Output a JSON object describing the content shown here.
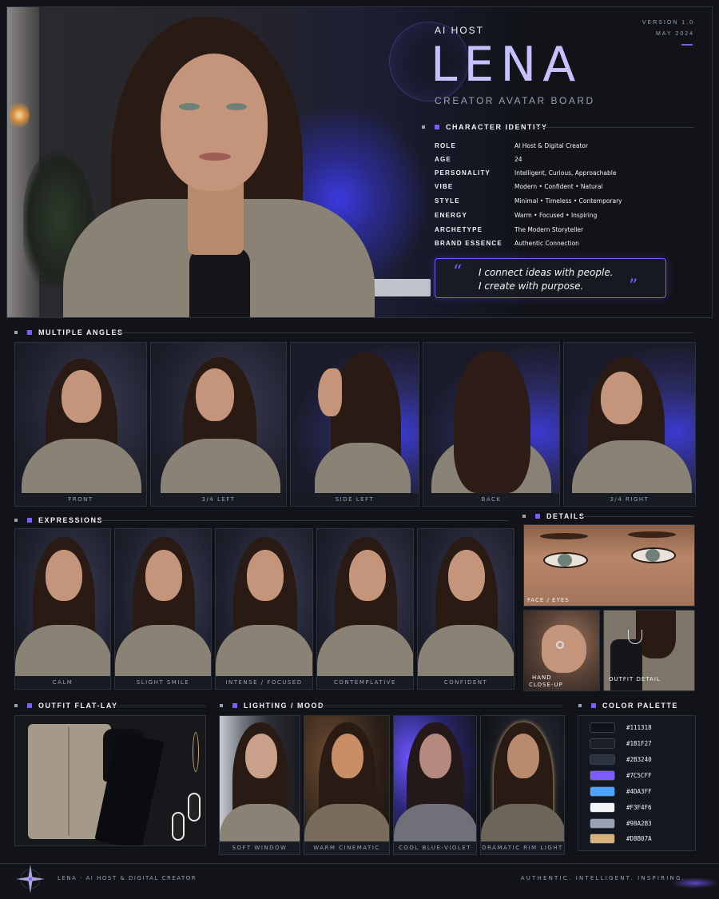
{
  "header": {
    "version": "VERSION 1.0",
    "date": "MAY 2024",
    "eyebrow": "AI HOST",
    "name": "LENA",
    "subtitle": "CREATOR AVATAR BOARD"
  },
  "identity": {
    "title": "CHARACTER IDENTITY",
    "rows": [
      {
        "key": "ROLE",
        "value": "AI Host & Digital Creator"
      },
      {
        "key": "AGE",
        "value": "24"
      },
      {
        "key": "PERSONALITY",
        "value": "Intelligent, Curious, Approachable"
      },
      {
        "key": "VIBE",
        "value": "Modern • Confident • Natural"
      },
      {
        "key": "STYLE",
        "value": "Minimal • Timeless • Contemporary"
      },
      {
        "key": "ENERGY",
        "value": "Warm • Focused • Inspiring"
      },
      {
        "key": "ARCHETYPE",
        "value": "The Modern Storyteller"
      },
      {
        "key": "BRAND ESSENCE",
        "value": "Authentic Connection"
      }
    ],
    "quote_line1": "I connect ideas with people.",
    "quote_line2": "I create with purpose.",
    "quote_open": "“",
    "quote_close": "”"
  },
  "angles": {
    "title": "MULTIPLE ANGLES",
    "items": [
      "FRONT",
      "3/4 LEFT",
      "SIDE LEFT",
      "BACK",
      "3/4 RIGHT"
    ]
  },
  "expressions": {
    "title": "EXPRESSIONS",
    "items": [
      "CALM",
      "SLIGHT SMILE",
      "INTENSE / FOCUSED",
      "CONTEMPLATIVE",
      "CONFIDENT"
    ]
  },
  "details": {
    "title": "DETAILS",
    "face_label": "FACE / EYES",
    "hand_label_1": "HAND",
    "hand_label_2": "CLOSE-UP",
    "outfit_label": "OUTFIT DETAIL"
  },
  "outfit": {
    "title": "OUTFIT FLAT-LAY"
  },
  "lighting": {
    "title": "LIGHTING / MOOD",
    "items": [
      "SOFT WINDOW LIGHT",
      "WARM CINEMATIC LIGHT",
      "COOL BLUE-VIOLET NIGHT",
      "DRAMATIC RIM LIGHT"
    ]
  },
  "palette": {
    "title": "COLOR PALETTE",
    "colors": [
      "#111318",
      "#1B1F27",
      "#2B3240",
      "#7C5CFF",
      "#4DA3FF",
      "#F3F4F6",
      "#98A2B3",
      "#D8B07A"
    ]
  },
  "footer": {
    "left": "LENA · AI HOST & DIGITAL CREATOR",
    "right": "AUTHENTIC. INTELLIGENT. INSPIRING."
  },
  "icons": {
    "quote": "quote-icon",
    "star": "compass-star-icon"
  }
}
